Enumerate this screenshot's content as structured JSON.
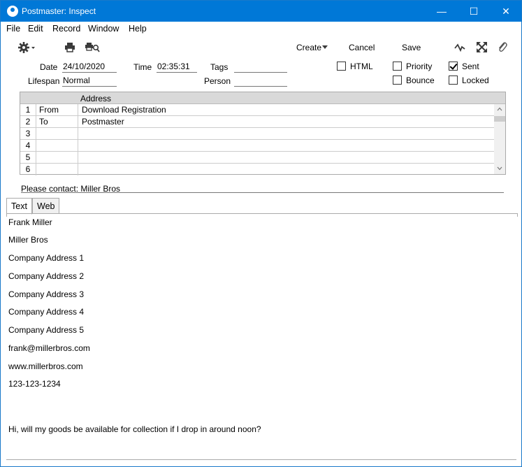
{
  "window": {
    "title": "Postmaster: Inspect",
    "minimize": "—",
    "maximize": "☐",
    "close": "✕"
  },
  "menu": [
    "File",
    "Edit",
    "Record",
    "Window",
    "Help"
  ],
  "toolbar": {
    "create": "Create",
    "cancel": "Cancel",
    "save": "Save"
  },
  "form": {
    "date_label": "Date",
    "date": "24/10/2020",
    "time_label": "Time",
    "time": "02:35:31",
    "tags_label": "Tags",
    "tags": "",
    "lifespan_label": "Lifespan",
    "lifespan": "Normal",
    "person_label": "Person",
    "person": "",
    "html_label": "HTML",
    "priority_label": "Priority",
    "sent_label": "Sent",
    "bounce_label": "Bounce",
    "locked_label": "Locked"
  },
  "grid": {
    "header": "Address",
    "rows": [
      {
        "n": "1",
        "type": "From",
        "address": "Download Registration"
      },
      {
        "n": "2",
        "type": "To",
        "address": "Postmaster"
      },
      {
        "n": "3",
        "type": "",
        "address": ""
      },
      {
        "n": "4",
        "type": "",
        "address": ""
      },
      {
        "n": "5",
        "type": "",
        "address": ""
      },
      {
        "n": "6",
        "type": "",
        "address": ""
      }
    ]
  },
  "contact": "Please contact: Miller Bros",
  "tabs": [
    "Text",
    "Web"
  ],
  "body_lines": [
    "Frank Miller",
    "Miller Bros",
    "Company Address 1",
    "Company Address 2",
    "Company Address 3",
    "Company Address 4",
    "Company Address 5",
    "frank@millerbros.com",
    "www.millerbros.com",
    "123-123-1234",
    "Hi, will my goods be available for collection if I drop in around noon?"
  ]
}
